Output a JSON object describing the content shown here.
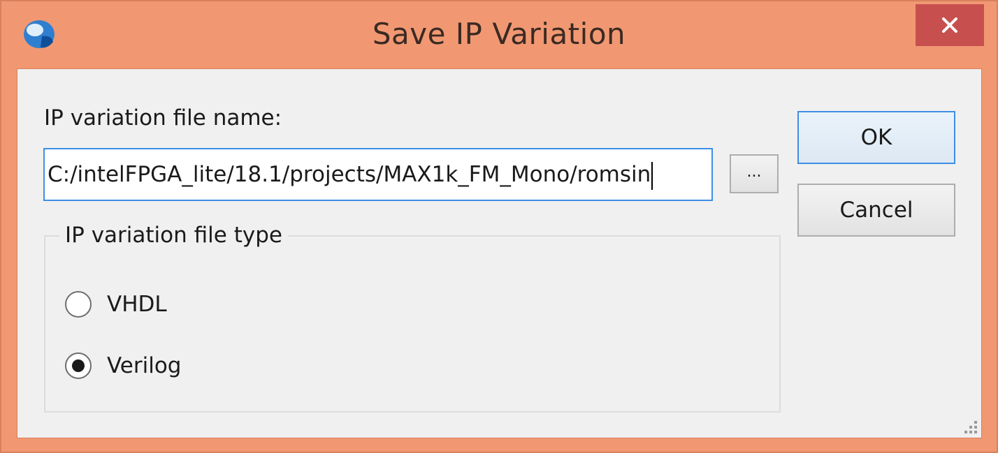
{
  "window": {
    "title": "Save IP Variation",
    "close_icon": "close-icon",
    "app_icon": "quartus-app-icon"
  },
  "filename": {
    "label": "IP variation file name:",
    "value": "C:/intelFPGA_lite/18.1/projects/MAX1k_FM_Mono/romsin",
    "browse_label": "..."
  },
  "filetype": {
    "legend": "IP variation file type",
    "options": [
      {
        "label": "VHDL",
        "selected": false
      },
      {
        "label": "Verilog",
        "selected": true
      }
    ]
  },
  "buttons": {
    "ok_label": "OK",
    "cancel_label": "Cancel"
  },
  "colors": {
    "frame": "#f19873",
    "close": "#c7504f",
    "focus_border": "#3d8ee6",
    "client_bg": "#f0f0f0"
  }
}
